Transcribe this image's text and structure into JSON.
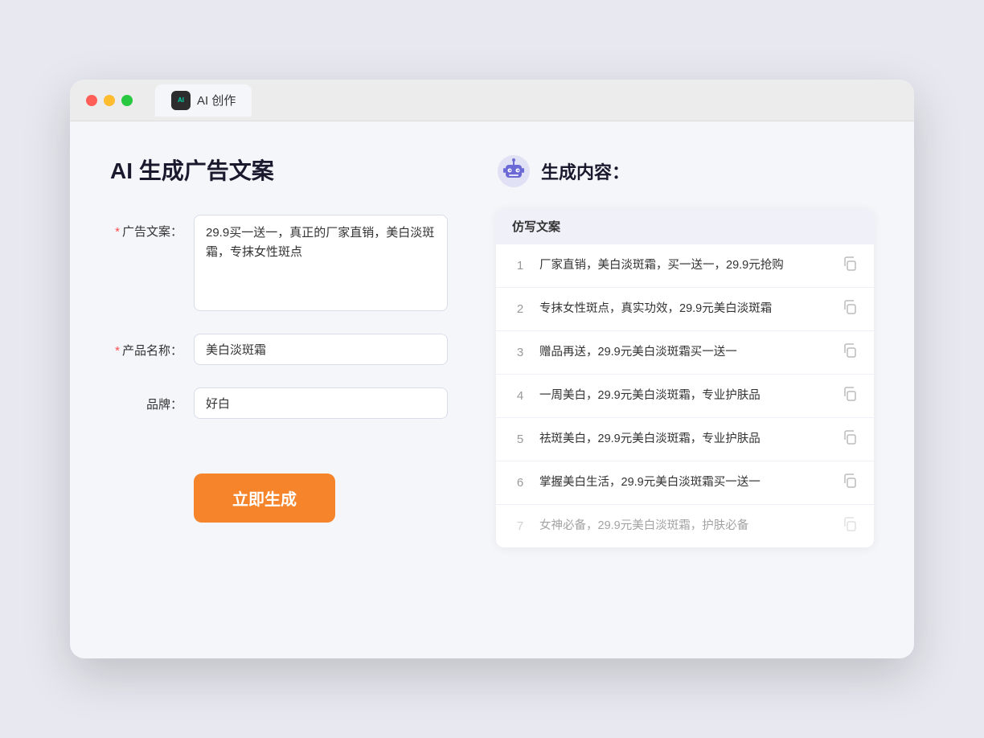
{
  "window": {
    "tab_label": "AI 创作"
  },
  "left_panel": {
    "title": "AI 生成广告文案",
    "fields": {
      "ad_copy_label": "广告文案：",
      "ad_copy_value": "29.9买一送一，真正的厂家直销，美白淡斑霜，专抹女性斑点",
      "product_name_label": "产品名称：",
      "product_name_value": "美白淡斑霜",
      "brand_label": "品牌：",
      "brand_value": "好白"
    },
    "button_label": "立即生成"
  },
  "right_panel": {
    "title": "生成内容：",
    "table_header": "仿写文案",
    "results": [
      {
        "num": "1",
        "text": "厂家直销，美白淡斑霜，买一送一，29.9元抢购"
      },
      {
        "num": "2",
        "text": "专抹女性斑点，真实功效，29.9元美白淡斑霜"
      },
      {
        "num": "3",
        "text": "赠品再送，29.9元美白淡斑霜买一送一"
      },
      {
        "num": "4",
        "text": "一周美白，29.9元美白淡斑霜，专业护肤品"
      },
      {
        "num": "5",
        "text": "祛斑美白，29.9元美白淡斑霜，专业护肤品"
      },
      {
        "num": "6",
        "text": "掌握美白生活，29.9元美白淡斑霜买一送一"
      },
      {
        "num": "7",
        "text": "女神必备，29.9元美白淡斑霜，护肤必备",
        "faded": true
      }
    ]
  }
}
